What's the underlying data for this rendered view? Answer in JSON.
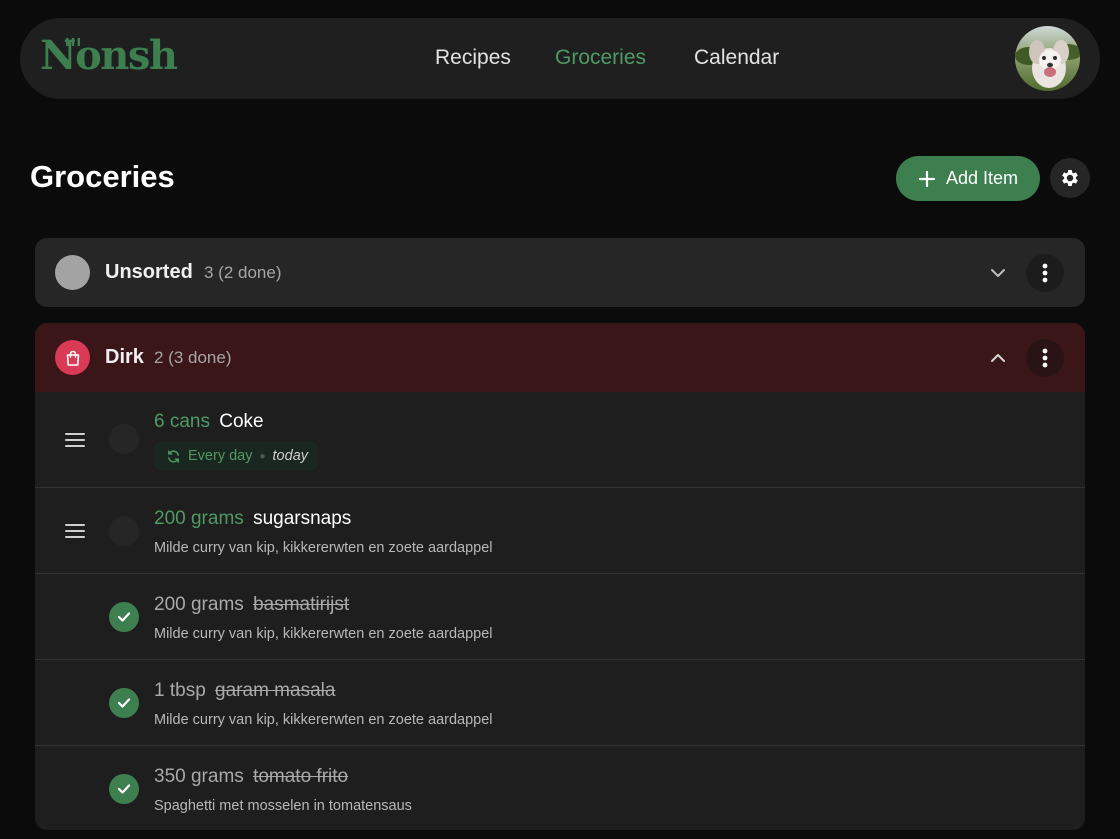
{
  "app": {
    "logo_text": "Nonsh"
  },
  "nav": {
    "items": [
      {
        "label": "Recipes",
        "active": false
      },
      {
        "label": "Groceries",
        "active": true
      },
      {
        "label": "Calendar",
        "active": false
      }
    ]
  },
  "page": {
    "title": "Groceries",
    "add_label": "Add Item"
  },
  "stores": [
    {
      "name": "Unsorted",
      "count": "3 (2 done)",
      "expanded": false,
      "color": "#a3a3a3"
    },
    {
      "name": "Dirk",
      "count": "2 (3 done)",
      "expanded": true,
      "color": "#d93a55"
    }
  ],
  "items": [
    {
      "qty": "6 cans",
      "name": "Coke",
      "done": false,
      "recurrence": "Every day",
      "next": "today"
    },
    {
      "qty": "200 grams",
      "name": "sugarsnaps",
      "done": false,
      "recipe": "Milde curry van kip, kikkererwten en zoete aardappel"
    },
    {
      "qty": "200 grams",
      "name": "basmatirijst",
      "done": true,
      "recipe": "Milde curry van kip, kikkererwten en zoete aardappel"
    },
    {
      "qty": "1 tbsp",
      "name": "garam masala",
      "done": true,
      "recipe": "Milde curry van kip, kikkererwten en zoete aardappel"
    },
    {
      "qty": "350 grams",
      "name": "tomato frito",
      "done": true,
      "recipe": "Spaghetti met mosselen in tomatensaus"
    }
  ],
  "colors": {
    "accent": "#3d7f4f",
    "accent_text": "#4f9a63",
    "dirk_bg": "#3a1619"
  }
}
